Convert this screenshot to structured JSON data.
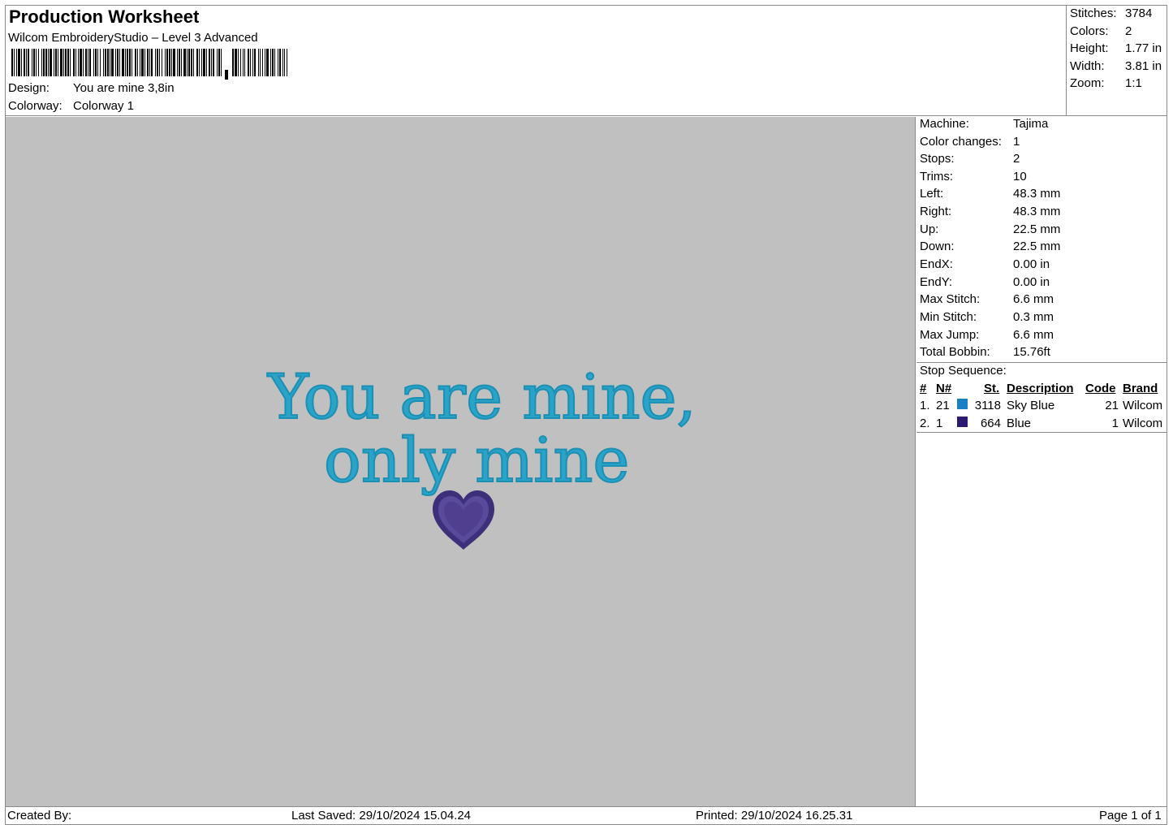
{
  "header": {
    "title": "Production Worksheet",
    "subtitle": "Wilcom EmbroideryStudio – Level 3 Advanced",
    "design_label": "Design:",
    "design_value": "You are mine 3,8in",
    "colorway_label": "Colorway:",
    "colorway_value": "Colorway 1"
  },
  "stats": [
    {
      "label": "Stitches:",
      "value": "3784"
    },
    {
      "label": "Colors:",
      "value": "2"
    },
    {
      "label": "Height:",
      "value": "1.77 in"
    },
    {
      "label": "Width:",
      "value": "3.81 in"
    },
    {
      "label": "Zoom:",
      "value": "1:1"
    }
  ],
  "design_preview": {
    "line1": "You are mine,",
    "line2": "only mine",
    "text_color": "#2aa3c9",
    "heart_color": "#4f3f8e"
  },
  "machine_info": [
    {
      "label": "Machine:",
      "value": "Tajima"
    },
    {
      "label": "Color changes:",
      "value": "1"
    },
    {
      "label": "Stops:",
      "value": "2"
    },
    {
      "label": "Trims:",
      "value": "10"
    },
    {
      "label": "Left:",
      "value": "48.3 mm"
    },
    {
      "label": "Right:",
      "value": "48.3 mm"
    },
    {
      "label": "Up:",
      "value": "22.5 mm"
    },
    {
      "label": "Down:",
      "value": "22.5 mm"
    },
    {
      "label": "EndX:",
      "value": "0.00 in"
    },
    {
      "label": "EndY:",
      "value": "0.00 in"
    },
    {
      "label": "Max Stitch:",
      "value": "6.6 mm"
    },
    {
      "label": "Min Stitch:",
      "value": "0.3 mm"
    },
    {
      "label": "Max Jump:",
      "value": "6.6 mm"
    },
    {
      "label": "Total Bobbin:",
      "value": "15.76ft"
    }
  ],
  "stop_sequence": {
    "title": "Stop Sequence:",
    "headers": {
      "index": "#",
      "n": "N#",
      "st": "St.",
      "description": "Description",
      "code": "Code",
      "brand": "Brand"
    },
    "rows": [
      {
        "index": "1.",
        "n": "21",
        "color": "#1a7fc4",
        "st": "3118",
        "description": "Sky Blue",
        "code": "21",
        "brand": "Wilcom"
      },
      {
        "index": "2.",
        "n": "1",
        "color": "#2b1a6e",
        "st": "664",
        "description": "Blue",
        "code": "1",
        "brand": "Wilcom"
      }
    ]
  },
  "footer": {
    "created_by": "Created By:",
    "last_saved": "Last Saved: 29/10/2024 15.04.24",
    "printed": "Printed: 29/10/2024 16.25.31",
    "page": "Page 1 of 1"
  }
}
